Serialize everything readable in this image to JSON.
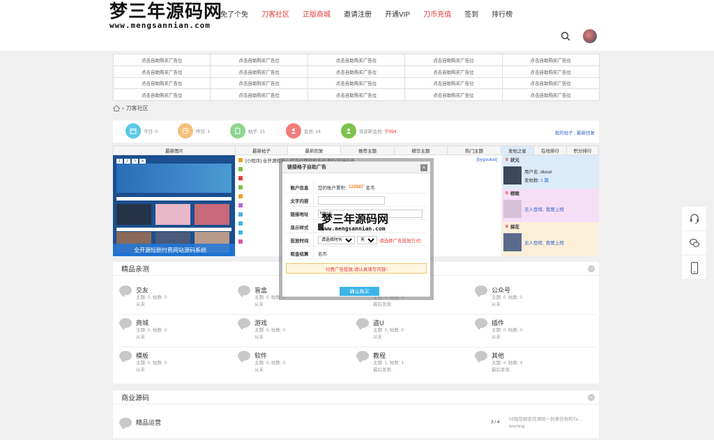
{
  "logo": {
    "cn": "梦三年源码网",
    "en": "www.mengsannian.com"
  },
  "nav": [
    {
      "label": "免了个免",
      "red": false
    },
    {
      "label": "刀客社区",
      "red": true
    },
    {
      "label": "正版商城",
      "red": true
    },
    {
      "label": "邀请注册",
      "red": false
    },
    {
      "label": "开通VIP",
      "red": false
    },
    {
      "label": "刀币充值",
      "red": true
    },
    {
      "label": "签到",
      "red": false
    },
    {
      "label": "排行榜",
      "red": false
    }
  ],
  "ad_cell": "点击自助购买广告位",
  "breadcrumb": {
    "current": "刀客社区"
  },
  "stats": {
    "today": "今日: 0",
    "yesterday": "昨日: 1",
    "posts": "帖子: 15",
    "members": "会员: 14",
    "welcome_prefix": "欢迎新会员:",
    "welcome_user": "宁894",
    "my_posts": "我的帖子",
    "latest_reply": "最新回复"
  },
  "tabs": [
    "最新图片",
    "最新帖子",
    "最新回复",
    "推荐主题",
    "精华主题",
    "热门主题",
    "发帖之星",
    "在线排行",
    "积分排行"
  ],
  "left_image": {
    "pager": [
      "1",
      "2",
      "3",
      "4"
    ],
    "caption": "全开源短剧付费网站源码系统"
  },
  "posts": [
    {
      "title": "[小程序] 全开源短剧小程序付费短剧系统源码/支持抖音",
      "user": "[bygoukai]",
      "color": "#f0a020"
    },
    {
      "title": "",
      "user": "",
      "color": "#7cc24a"
    },
    {
      "title": "",
      "user": "",
      "color": "#e4393c"
    },
    {
      "title": "",
      "user": "",
      "color": "#7cc24a"
    },
    {
      "title": "",
      "user": "",
      "color": "#f0a020"
    },
    {
      "title": "",
      "user": "",
      "color": "#b36ad6"
    },
    {
      "title": "",
      "user": "",
      "color": "#4fb3e8"
    },
    {
      "title": "",
      "user": "",
      "color": "#3bb4e8"
    },
    {
      "title": "",
      "user": "",
      "color": "#3bb4e8"
    },
    {
      "title": "",
      "user": "",
      "color": "#d45aa0"
    }
  ],
  "rank": {
    "first": {
      "label": "状元",
      "username_label": "用户名:",
      "username": "dkewl",
      "count_label": "发帖数:",
      "count": "1 篇"
    },
    "second": {
      "label": "榜眼",
      "empty": "无人登榜,",
      "cta": "我要上榜"
    },
    "third": {
      "label": "探花",
      "empty": "无人登榜,",
      "cta": "我要上榜"
    }
  },
  "section1": {
    "title": "精品亲测",
    "toggle": "−",
    "forums": [
      {
        "name": "交友",
        "meta1": "主题: 0, 帖数: 0",
        "meta2": "从未"
      },
      {
        "name": "盲盒",
        "meta1": "主题: 0, 帖数: 0",
        "meta2": "从未"
      },
      {
        "name": "",
        "meta1": "主题: 3, 帖数: 4",
        "meta2": "最后发表:"
      },
      {
        "name": "公众号",
        "meta1": "主题: 0, 帖数: 0",
        "meta2": "从未"
      },
      {
        "name": "商城",
        "meta1": "主题: 0, 帖数: 0",
        "meta2": "从未"
      },
      {
        "name": "游戏",
        "meta1": "主题: 0, 帖数: 0",
        "meta2": "从未"
      },
      {
        "name": "盗U",
        "meta1": "主题: 0, 帖数: 0",
        "meta2": "从未"
      },
      {
        "name": "插件",
        "meta1": "主题: 0, 帖数: 0",
        "meta2": "从未"
      },
      {
        "name": "模板",
        "meta1": "主题: 0, 帖数: 0",
        "meta2": "从未"
      },
      {
        "name": "软件",
        "meta1": "主题: 0, 帖数: 0",
        "meta2": "从未"
      },
      {
        "name": "教程",
        "meta1": "主题: 1, 帖数: 1",
        "meta2": "最后发表:"
      },
      {
        "name": "其他",
        "meta1": "主题: 4, 帖数: 4",
        "meta2": "最后发表:"
      }
    ]
  },
  "section2": {
    "title": "商业源码",
    "toggle": "−",
    "forum": {
      "name": "精品运营",
      "count": "3 / 4",
      "last_title": "h5短信群名信源码一封来信你的Ta ...",
      "last_user": "wuming"
    }
  },
  "modal": {
    "title": "链接格子自助广告",
    "close": "×",
    "account_label": "账户信息",
    "account_text": "您的账户累积:",
    "account_amount": "120587",
    "account_unit": "名币",
    "text_label": "文字内容",
    "link_label": "链接地址",
    "link_value": "http://",
    "style_label": "显示样式",
    "time_label": "投放时间",
    "time_select": "请选择时长",
    "time_unit": "天",
    "time_hint": "请选择广告投放方式!",
    "cost_label": "租金结算",
    "cost_unit": "名币",
    "warning": "付费广告投放,请认真填写内容!",
    "confirm": "确认购买"
  },
  "colors": {
    "accent_red": "#e4393c",
    "link_blue": "#3366cc",
    "button_blue": "#3bb4e8"
  }
}
